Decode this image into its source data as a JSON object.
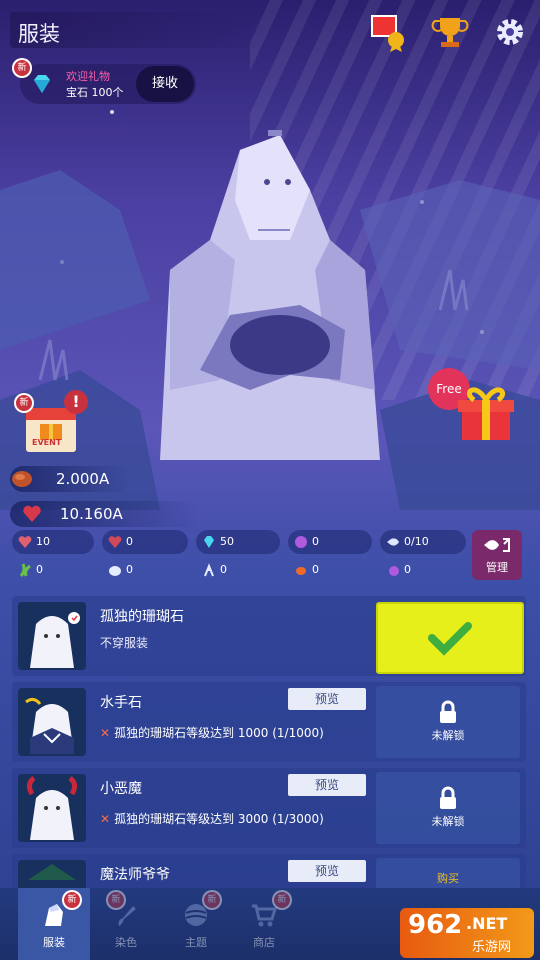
{
  "header": {
    "title": "服装"
  },
  "gift": {
    "title": "欢迎礼物",
    "reward": "宝石 100个",
    "receive_label": "接收",
    "badge": "新"
  },
  "event": {
    "badge": "新",
    "label": "EVENT"
  },
  "free_gift": {
    "label": "Free"
  },
  "resources": {
    "food": "2.000A",
    "hearts": "10.160A"
  },
  "stats": {
    "row1": [
      "10",
      "0",
      "50",
      "0",
      "0/10"
    ],
    "row2": [
      "0",
      "0",
      "0",
      "0",
      "0"
    ]
  },
  "manage": {
    "label": "管理"
  },
  "outfits": [
    {
      "name": "孤独的珊瑚石",
      "subtitle": "不穿服装",
      "equipped": true
    },
    {
      "name": "水手石",
      "preview_label": "预览",
      "requirement": "孤独的珊瑚石等级达到 1000 (1/1000)",
      "lock_label": "未解锁"
    },
    {
      "name": "小恶魔",
      "preview_label": "预览",
      "requirement": "孤独的珊瑚石等级达到 3000 (1/3000)",
      "lock_label": "未解锁"
    },
    {
      "name": "魔法师爷爷",
      "preview_label": "预览",
      "buy_label": "购买"
    }
  ],
  "nav": [
    {
      "label": "服装",
      "badge": "新",
      "active": true
    },
    {
      "label": "染色",
      "badge": "新"
    },
    {
      "label": "主题",
      "badge": "新"
    },
    {
      "label": "商店",
      "badge": "新"
    }
  ],
  "watermark": {
    "number": "962",
    "suffix": ".NET",
    "site": "乐游网"
  },
  "colors": {
    "accent_yellow": "#e6ef1a",
    "badge_red": "#c8323e",
    "check_green": "#3fae3f"
  }
}
